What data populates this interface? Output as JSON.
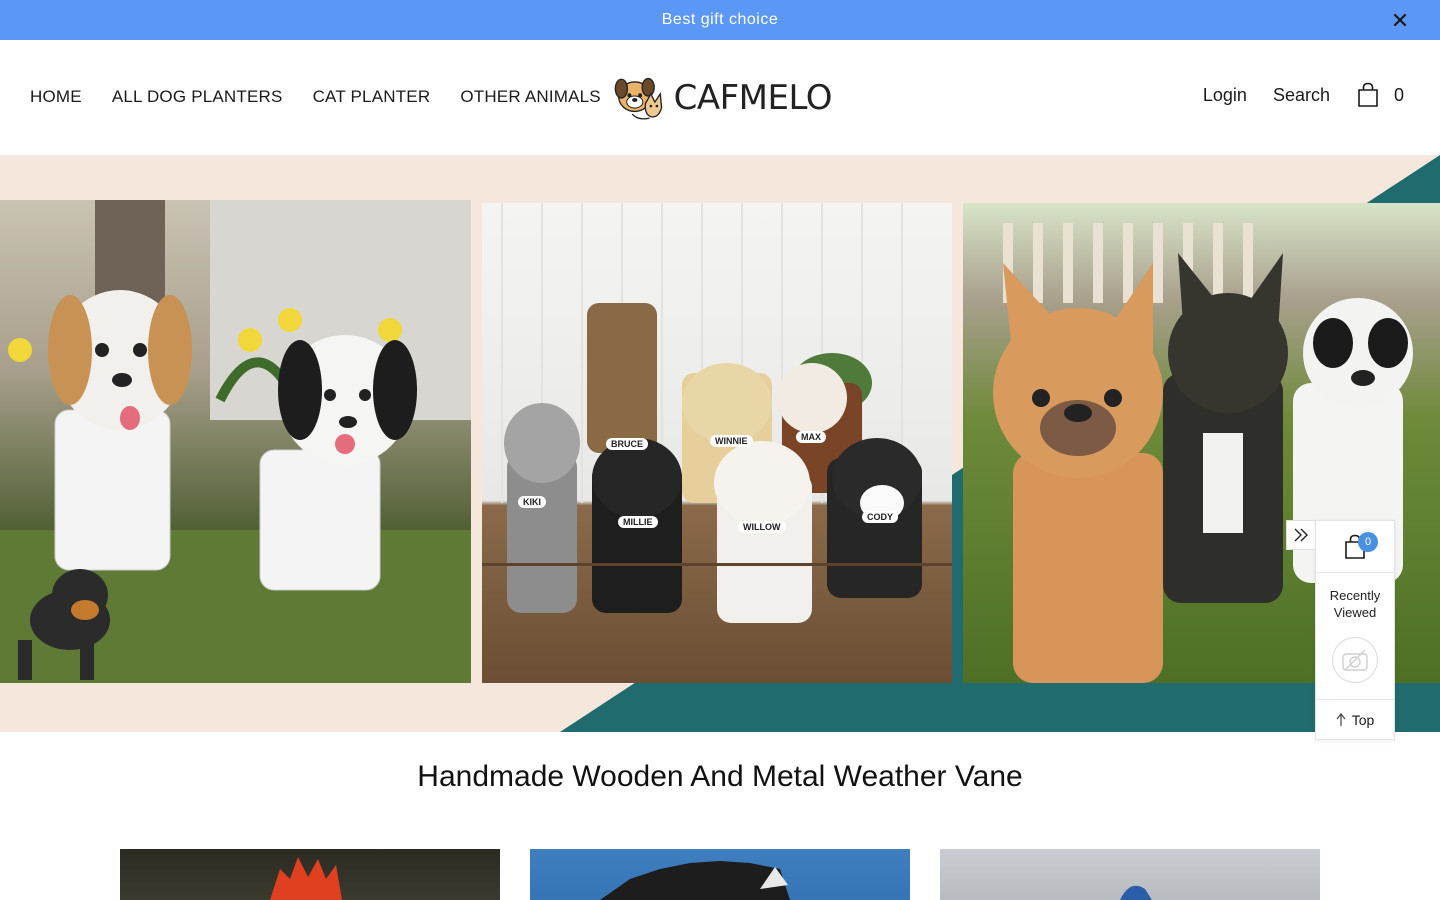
{
  "announcement": {
    "text": "Best gift choice",
    "close_icon": "close-icon"
  },
  "nav": {
    "items": [
      {
        "label": "HOME"
      },
      {
        "label": "ALL DOG PLANTERS"
      },
      {
        "label": "CAT PLANTER"
      },
      {
        "label": "OTHER ANIMALS"
      },
      {
        "label": "..."
      }
    ]
  },
  "logo": {
    "text": "CAFMELO"
  },
  "header": {
    "login_label": "Login",
    "search_label": "Search",
    "cart_count": "0",
    "cart_icon": "shopping-bag-icon"
  },
  "hero": {
    "dog_labels": [
      "BRUCE",
      "WINNIE",
      "MAX",
      "KIKI",
      "MILLIE",
      "WILLOW",
      "CODY"
    ]
  },
  "sidebar_widget": {
    "cart_count": "0",
    "recently_viewed_label": "Recently Viewed",
    "top_label": "Top"
  },
  "section": {
    "title": "Handmade Wooden And Metal Weather Vane"
  },
  "colors": {
    "announcement_bg": "#5b97f7",
    "hero_teal": "#1f6b6e",
    "hero_peach": "#f5e7dc",
    "badge": "#4a90e2"
  }
}
